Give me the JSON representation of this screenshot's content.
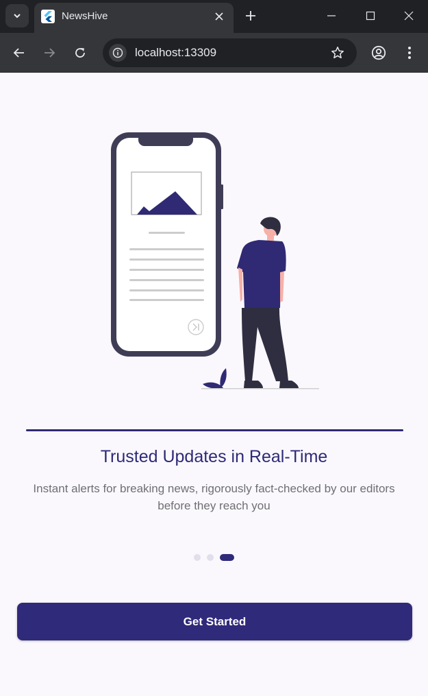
{
  "browser": {
    "tab_title": "NewsHive",
    "url": "localhost:13309",
    "icons": {
      "tab_search": "chevron-down-icon",
      "favicon": "flutter-logo-icon",
      "close_tab": "close-icon",
      "new_tab": "plus-icon",
      "minimize": "minimize-icon",
      "maximize": "maximize-icon",
      "close_window": "close-icon",
      "back": "arrow-left-icon",
      "forward": "arrow-right-icon",
      "reload": "reload-icon",
      "site_info": "info-icon",
      "bookmark": "star-icon",
      "profile": "account-circle-icon",
      "menu": "more-vert-icon"
    }
  },
  "onboarding": {
    "title": "Trusted Updates in Real-Time",
    "description": "Instant alerts for breaking news, rigorously fact-checked by our editors before they reach you",
    "page_indicator": {
      "total": 3,
      "current": 3
    },
    "button_label": "Get Started",
    "colors": {
      "primary": "#2f2a7a",
      "title": "#2d2a77",
      "text_secondary": "#6f6f73",
      "background": "#faf8fd",
      "dot_inactive": "#e2dfeb"
    }
  }
}
